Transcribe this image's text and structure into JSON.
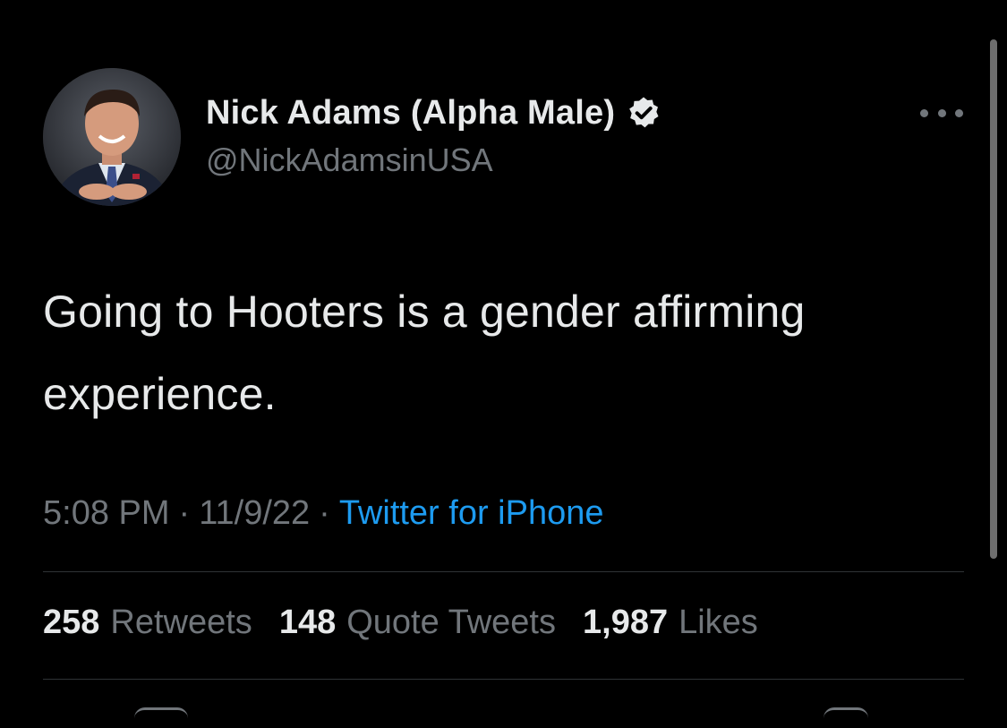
{
  "author": {
    "display_name": "Nick Adams (Alpha Male)",
    "handle": "@NickAdamsinUSA",
    "verified": true,
    "avatar": "profile-photo"
  },
  "tweet": {
    "text": "Going to Hooters is a gender affirming experience.",
    "time": "5:08 PM",
    "separator": "·",
    "date": "11/9/22",
    "source": "Twitter for iPhone"
  },
  "stats": {
    "retweets_count": "258",
    "retweets_label": "Retweets",
    "quotes_count": "148",
    "quotes_label": "Quote Tweets",
    "likes_count": "1,987",
    "likes_label": "Likes"
  },
  "icons": {
    "more": "more-horizontal-icon",
    "verified": "verified-badge-icon"
  },
  "colors": {
    "background": "#000000",
    "primary_text": "#e7e9ea",
    "secondary_text": "#71767b",
    "link": "#1d9bf0",
    "divider": "#2f3336"
  }
}
